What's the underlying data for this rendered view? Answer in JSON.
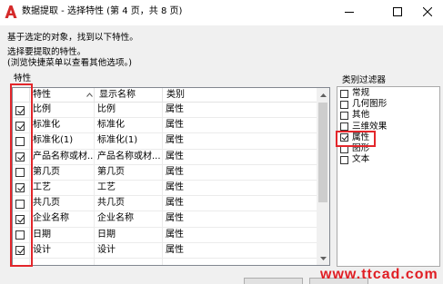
{
  "window": {
    "title": "数据提取 - 选择特性 (第 4 页，共 8 页)",
    "icons": {
      "app": "autocad-logo-icon",
      "minimize": "minimize-icon",
      "maximize": "maximize-icon",
      "close": "close-icon"
    }
  },
  "intro": {
    "found_text": "基于选定的对象，找到以下特性。",
    "select_text": "选择要提取的特性。",
    "hint_text": "(浏览快捷菜单以查看其他选项。)"
  },
  "properties": {
    "group_label": "特性",
    "columns": {
      "property": "特性",
      "display_name": "显示名称",
      "category": "类别"
    },
    "sort_icon": "sort-ascending-icon",
    "rows": [
      {
        "checked": true,
        "property": "比例",
        "display_name": "比例",
        "category": "属性"
      },
      {
        "checked": true,
        "property": "标准化",
        "display_name": "标准化",
        "category": "属性"
      },
      {
        "checked": false,
        "property": "标准化(1)",
        "display_name": "标准化(1)",
        "category": "属性"
      },
      {
        "checked": true,
        "property": "产品名称或材...",
        "display_name": "产品名称或材...",
        "category": "属性"
      },
      {
        "checked": false,
        "property": "第几页",
        "display_name": "第几页",
        "category": "属性"
      },
      {
        "checked": true,
        "property": "工艺",
        "display_name": "工艺",
        "category": "属性"
      },
      {
        "checked": false,
        "property": "共几页",
        "display_name": "共几页",
        "category": "属性"
      },
      {
        "checked": true,
        "property": "企业名称",
        "display_name": "企业名称",
        "category": "属性"
      },
      {
        "checked": false,
        "property": "日期",
        "display_name": "日期",
        "category": "属性"
      },
      {
        "checked": true,
        "property": "设计",
        "display_name": "设计",
        "category": "属性"
      }
    ]
  },
  "category_filter": {
    "group_label": "类别过滤器",
    "items": [
      {
        "label": "常规",
        "checked": false
      },
      {
        "label": "几何图形",
        "checked": false
      },
      {
        "label": "其他",
        "checked": false
      },
      {
        "label": "三维效果",
        "checked": false
      },
      {
        "label": "属性",
        "checked": true
      },
      {
        "label": "图形",
        "checked": false
      },
      {
        "label": "文本",
        "checked": false
      }
    ]
  },
  "colors": {
    "annotation_box": "#e3262b",
    "watermark": "#e01e24",
    "app_icon": "#d52a2a"
  },
  "watermark": "www.ttcad.com"
}
